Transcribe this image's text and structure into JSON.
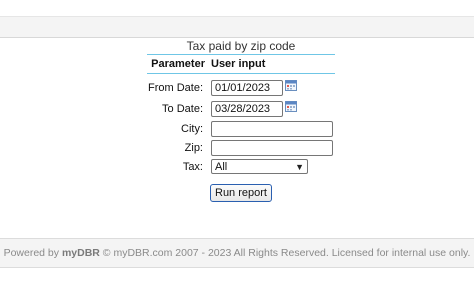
{
  "report": {
    "title": "Tax paid by zip code",
    "headers": {
      "parameter": "Parameter",
      "input": "User input"
    }
  },
  "params": {
    "from_date": {
      "label": "From Date:",
      "value": "01/01/2023",
      "icon": "calendar-icon"
    },
    "to_date": {
      "label": "To Date:",
      "value": "03/28/2023",
      "icon": "calendar-icon"
    },
    "city": {
      "label": "City:",
      "value": ""
    },
    "zip": {
      "label": "Zip:",
      "value": ""
    },
    "tax": {
      "label": "Tax:",
      "selected": "All"
    }
  },
  "run_button": {
    "label": "Run report"
  },
  "footer": {
    "prefix": "Powered by ",
    "brand": "myDBR",
    "rest": " © myDBR.com 2007 - 2023 All Rights Reserved. Licensed for internal use only."
  },
  "colors": {
    "rule": "#6fc6e6",
    "button_border": "#2a5fb0"
  }
}
